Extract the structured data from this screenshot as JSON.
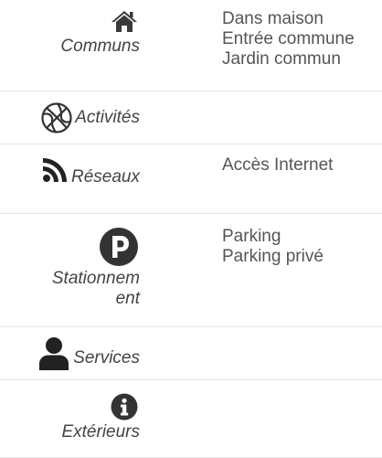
{
  "categories": [
    {
      "label": "Communs",
      "icon": "house-icon",
      "features": [
        "Dans maison",
        "Entrée commune",
        "Jardin commun"
      ]
    },
    {
      "label": "Activités",
      "icon": "basketball-icon",
      "features": []
    },
    {
      "label": "Réseaux",
      "icon": "rss-icon",
      "features": [
        "Accès Internet"
      ]
    },
    {
      "label": "Stationnem ent",
      "label_lines": [
        "Stationnem",
        "ent"
      ],
      "icon": "parking-icon",
      "features": [
        "Parking",
        "Parking privé"
      ]
    },
    {
      "label": "Services",
      "icon": "user-icon",
      "features": []
    },
    {
      "label": "Extérieurs",
      "icon": "info-icon",
      "features": []
    }
  ]
}
